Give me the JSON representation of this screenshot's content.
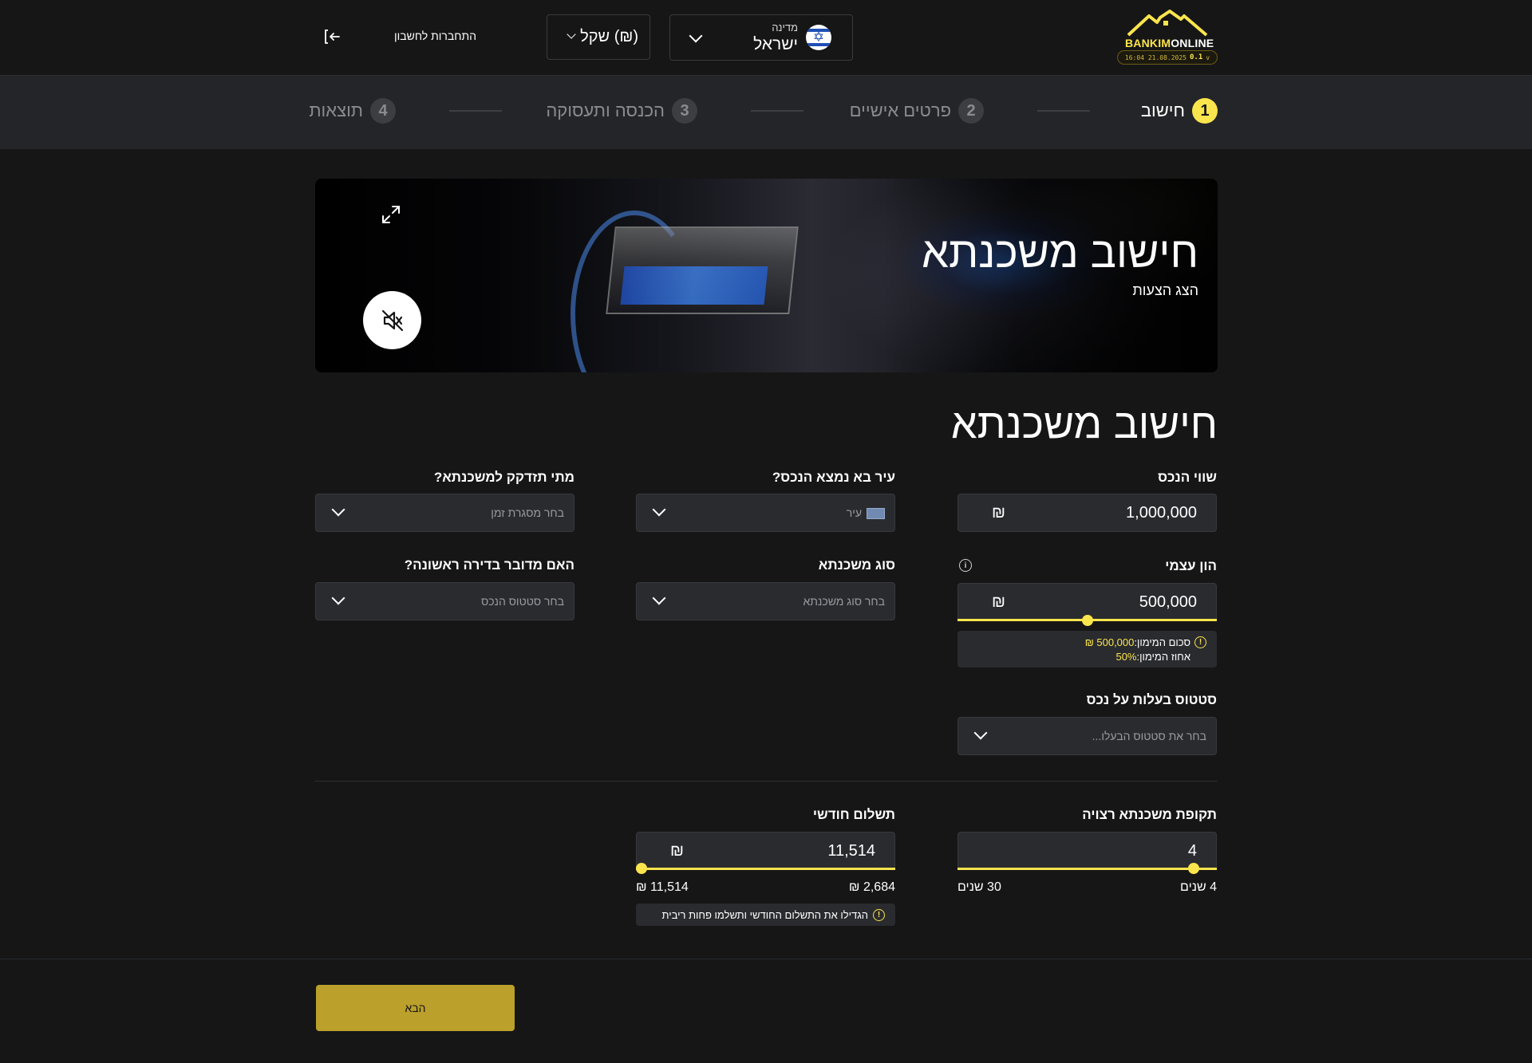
{
  "header": {
    "logo": {
      "brand_part1": "BANKIM",
      "brand_part2": "ONLINE",
      "timestamp": "16:04 21.08.2025",
      "version": "0.1"
    },
    "country": {
      "label": "מדינה",
      "value": "ישראל",
      "icon": "israel-flag-icon"
    },
    "currency": {
      "value": "(₪) שקל"
    },
    "login": {
      "label": "התחברות לחשבון",
      "icon": "login-arrow-icon"
    }
  },
  "stepper": {
    "steps": [
      {
        "number": "1",
        "label": "חישוב",
        "active": true
      },
      {
        "number": "2",
        "label": "פרטים אישיים",
        "active": false
      },
      {
        "number": "3",
        "label": "הכנסה ותעסוקה",
        "active": false
      },
      {
        "number": "4",
        "label": "תוצאות",
        "active": false
      }
    ]
  },
  "video": {
    "title": "חישוב משכנתא",
    "subtitle": "הצג הצעות",
    "expand_icon": "expand-icon",
    "mute_icon": "muted-speaker-icon"
  },
  "form": {
    "title": "חישוב משכנתא",
    "property_value": {
      "label": "שווי הנכס",
      "value": "1,000,000",
      "currency": "₪"
    },
    "city": {
      "label": "עיר בא נמצא הנכס?",
      "placeholder": "עיר"
    },
    "when_needed": {
      "label": "מתי תזדקק למשכנתא?",
      "placeholder": "בחר מסגרת זמן"
    },
    "equity": {
      "label": "הון עצמי",
      "value": "500,000",
      "currency": "₪",
      "slider_fraction": 0.5,
      "info_amount_label": "סכום המימון:",
      "info_amount_value": "500,000 ₪",
      "info_percent_label": "אחוז המימון:",
      "info_percent_value": "50%"
    },
    "mortgage_type": {
      "label": "סוג משכנתא",
      "placeholder": "בחר סוג משכנתא"
    },
    "first_apartment": {
      "label": "האם מדובר בדירה ראשונה?",
      "placeholder": "בחר סטטוס הנכס"
    },
    "ownership_status": {
      "label": "סטטוס בעלות על נכס",
      "placeholder": "בחר את סטטוס הבעלו..."
    },
    "period": {
      "label": "תקופת משכנתא רצויה",
      "value": "4",
      "min_label": "4 שנים",
      "max_label": "30 שנים",
      "slider_fraction": 0.0
    },
    "monthly_payment": {
      "label": "תשלום חודשי",
      "value": "11,514",
      "currency": "₪",
      "min_label": "2,684 ₪",
      "max_label": "11,514 ₪",
      "slider_fraction": 1.0,
      "tip": "הגדילו את התשלום החודשי ותשלמו פחות ריבית"
    }
  },
  "footer": {
    "next_label": "הבא"
  },
  "colors": {
    "accent": "#FBE54D",
    "button": "#BBA02B",
    "background": "#161616",
    "field": "#2a2b2f"
  }
}
